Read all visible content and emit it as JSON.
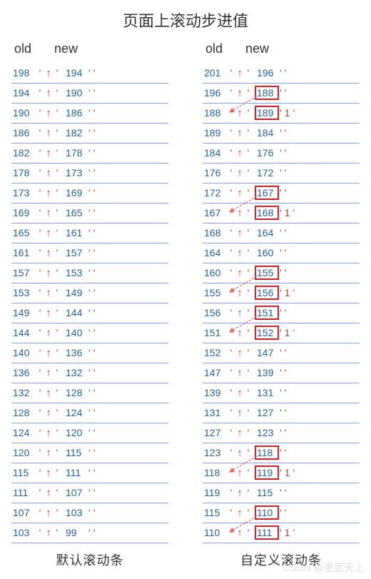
{
  "title": "页面上滚动步进值",
  "headers": {
    "old": "old",
    "new": "new"
  },
  "left": {
    "footer": "默认滚动条",
    "rows": [
      {
        "old": "198",
        "new": "194"
      },
      {
        "old": "194",
        "new": "190"
      },
      {
        "old": "190",
        "new": "186"
      },
      {
        "old": "186",
        "new": "182"
      },
      {
        "old": "182",
        "new": "178"
      },
      {
        "old": "178",
        "new": "173"
      },
      {
        "old": "173",
        "new": "169"
      },
      {
        "old": "169",
        "new": "165"
      },
      {
        "old": "165",
        "new": "161"
      },
      {
        "old": "161",
        "new": "157"
      },
      {
        "old": "157",
        "new": "153"
      },
      {
        "old": "153",
        "new": "149"
      },
      {
        "old": "149",
        "new": "144"
      },
      {
        "old": "144",
        "new": "140"
      },
      {
        "old": "140",
        "new": "136"
      },
      {
        "old": "136",
        "new": "132"
      },
      {
        "old": "132",
        "new": "128"
      },
      {
        "old": "128",
        "new": "124"
      },
      {
        "old": "124",
        "new": "120"
      },
      {
        "old": "120",
        "new": "115"
      },
      {
        "old": "115",
        "new": "111"
      },
      {
        "old": "111",
        "new": "107"
      },
      {
        "old": "107",
        "new": "103"
      },
      {
        "old": "103",
        "new": "99"
      }
    ]
  },
  "right": {
    "footer": "自定义滚动条",
    "rows": [
      {
        "old": "201",
        "new": "196"
      },
      {
        "old": "196",
        "new": "188",
        "boxed": true
      },
      {
        "old": "188",
        "new": "189",
        "boxed": true,
        "trail": "1",
        "diag": true
      },
      {
        "old": "189",
        "new": "184"
      },
      {
        "old": "184",
        "new": "176"
      },
      {
        "old": "176",
        "new": "172"
      },
      {
        "old": "172",
        "new": "167",
        "boxed": true
      },
      {
        "old": "167",
        "new": "168",
        "boxed": true,
        "trail": "1",
        "diag": true
      },
      {
        "old": "168",
        "new": "164"
      },
      {
        "old": "164",
        "new": "160"
      },
      {
        "old": "160",
        "new": "155",
        "boxed": true
      },
      {
        "old": "155",
        "new": "156",
        "boxed": true,
        "trail": "1",
        "diag": true
      },
      {
        "old": "156",
        "new": "151",
        "boxed": true
      },
      {
        "old": "151",
        "new": "152",
        "boxed": true,
        "trail": "1",
        "diag": true
      },
      {
        "old": "152",
        "new": "147"
      },
      {
        "old": "147",
        "new": "139"
      },
      {
        "old": "139",
        "new": "131"
      },
      {
        "old": "131",
        "new": "127"
      },
      {
        "old": "127",
        "new": "123"
      },
      {
        "old": "123",
        "new": "118",
        "boxed": true
      },
      {
        "old": "118",
        "new": "119",
        "boxed": true,
        "trail": "1",
        "diag": true
      },
      {
        "old": "119",
        "new": "115"
      },
      {
        "old": "115",
        "new": "110",
        "boxed": true
      },
      {
        "old": "110",
        "new": "111",
        "boxed": true,
        "trail": "1",
        "diag": true
      }
    ]
  },
  "glyphs": {
    "up_arrow": "↑",
    "quote": "'"
  },
  "watermark": "CSDN @墨蓝天上"
}
